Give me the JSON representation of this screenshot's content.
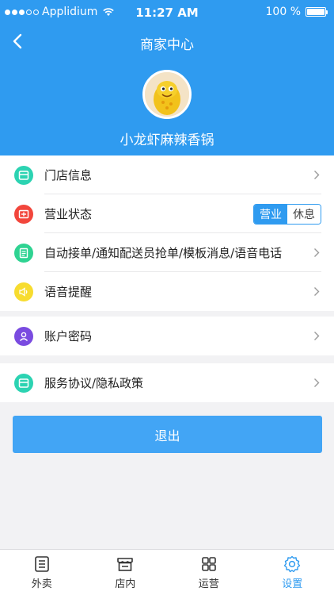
{
  "status_bar": {
    "carrier": "Applidium",
    "time": "11:27 AM",
    "battery": "100 %"
  },
  "header": {
    "title": "商家中心",
    "store_name": "小龙虾麻辣香锅"
  },
  "settings": {
    "group1": [
      {
        "label": "门店信息",
        "icon": "store-icon",
        "color": "#2cd3b2"
      },
      {
        "label": "营业状态",
        "icon": "status-icon",
        "color": "#f2463c"
      },
      {
        "label": "自动接单/通知配送员抢单/模板消息/语音电话",
        "icon": "document-icon",
        "color": "#2fd392"
      },
      {
        "label": "语音提醒",
        "icon": "speaker-icon",
        "color": "#f7dc2f"
      }
    ],
    "business_toggle": {
      "on": "营业",
      "off": "休息"
    },
    "group2": [
      {
        "label": "账户密码",
        "icon": "user-icon",
        "color": "#7a4be0"
      }
    ],
    "group3": [
      {
        "label": "服务协议/隐私政策",
        "icon": "agreement-icon",
        "color": "#2cd3b2"
      }
    ]
  },
  "logout_label": "退出",
  "tabbar": [
    {
      "label": "外卖",
      "icon": "list-icon",
      "active": false
    },
    {
      "label": "店内",
      "icon": "shop-icon",
      "active": false
    },
    {
      "label": "运营",
      "icon": "grid-icon",
      "active": false
    },
    {
      "label": "设置",
      "icon": "gear-icon",
      "active": true
    }
  ],
  "colors": {
    "primary": "#2f9bf0",
    "logout": "#42a5f5",
    "background": "#f2f2f4"
  }
}
